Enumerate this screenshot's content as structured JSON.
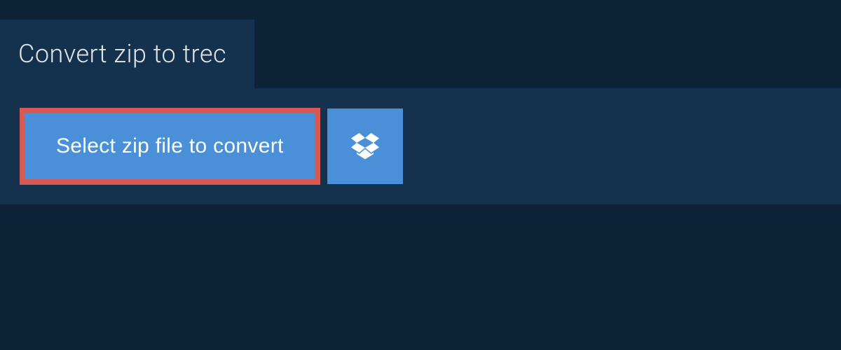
{
  "header": {
    "title": "Convert zip to trec"
  },
  "actions": {
    "select_file_label": "Select zip file to convert",
    "dropbox_icon_name": "dropbox"
  },
  "colors": {
    "page_bg": "#0d2438",
    "panel_bg": "#14324d",
    "button_bg": "#4a90d9",
    "highlight_border": "#d85a55",
    "text_light": "#e0e6ea"
  }
}
